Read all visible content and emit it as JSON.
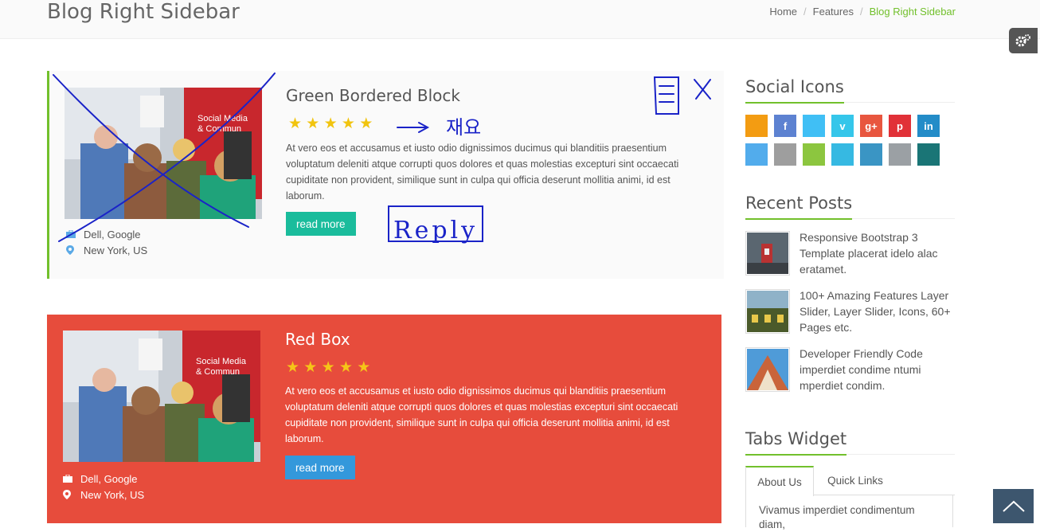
{
  "header": {
    "title": "Blog Right Sidebar",
    "breadcrumb": [
      {
        "label": "Home"
      },
      {
        "label": "Features"
      },
      {
        "label": "Blog Right Sidebar"
      }
    ]
  },
  "posts": [
    {
      "title": "Green Bordered Block",
      "rating": 5,
      "stars": "★ ★ ★ ★ ★",
      "text": "At vero eos et accusamus et iusto odio dignissimos ducimus qui blanditiis praesentium voluptatum deleniti atque corrupti quos dolores et quas molestias excepturi sint occaecati cupiditate non provident, similique sunt in culpa qui officia deserunt mollitia animi, id est laborum.",
      "button": "read more",
      "company": "Dell, Google",
      "location": "New York, US",
      "image_text": "Social Media & Commun",
      "accent": "#72c02c"
    },
    {
      "title": "Red Box",
      "rating": 5,
      "stars": "★ ★ ★ ★ ★",
      "text": "At vero eos et accusamus et iusto odio dignissimos ducimus qui blanditiis praesentium voluptatum deleniti atque corrupti quos dolores et quas molestias excepturi sint occaecati cupiditate non provident, similique sunt in culpa qui officia deserunt mollitia animi, id est laborum.",
      "button": "read more",
      "company": "Dell, Google",
      "location": "New York, US",
      "image_text": "Social Media & Commun",
      "accent": "#e74c3c"
    }
  ],
  "sidebar": {
    "social_heading": "Social Icons",
    "social_icons": [
      {
        "name": "rss-icon",
        "glyph": "",
        "color": "#f39c12"
      },
      {
        "name": "facebook-icon",
        "glyph": "f",
        "color": "#5d82d1"
      },
      {
        "name": "twitter-icon",
        "glyph": "",
        "color": "#40bff5"
      },
      {
        "name": "vimeo-icon",
        "glyph": "v",
        "color": "#35c6ea"
      },
      {
        "name": "googleplus-icon",
        "glyph": "g+",
        "color": "#e8563f"
      },
      {
        "name": "pinterest-icon",
        "glyph": "p",
        "color": "#e13138"
      },
      {
        "name": "linkedin-icon",
        "glyph": "in",
        "color": "#238cc8"
      },
      {
        "name": "dropbox-icon",
        "glyph": "",
        "color": "#52acec"
      },
      {
        "name": "picasa-icon",
        "glyph": "",
        "color": "#9e9e9e"
      },
      {
        "name": "odnoklassniki-icon",
        "glyph": "",
        "color": "#8cc63f"
      },
      {
        "name": "cloud-icon",
        "glyph": "",
        "color": "#36b9e2"
      },
      {
        "name": "wordpress-icon",
        "glyph": "",
        "color": "#3a95c4"
      },
      {
        "name": "github-icon",
        "glyph": "",
        "color": "#9ba0a4"
      },
      {
        "name": "xing-icon",
        "glyph": "",
        "color": "#1a7576"
      }
    ],
    "recent_heading": "Recent Posts",
    "recent_posts": [
      {
        "text": "Responsive Bootstrap 3 Template placerat idelo alac eratamet."
      },
      {
        "text": "100+ Amazing Features Layer Slider, Layer Slider, Icons, 60+ Pages etc."
      },
      {
        "text": "Developer Friendly Code imperdiet condime ntumi mperdiet condim."
      }
    ],
    "tabs_heading": "Tabs Widget",
    "tabs": [
      {
        "label": "About Us"
      },
      {
        "label": "Quick Links"
      }
    ],
    "tab_content": "Vivamus imperdiet condimentum diam,"
  },
  "annotations": {
    "korean_note": "재요",
    "reply_note": "Reply",
    "close_mark": "X"
  }
}
